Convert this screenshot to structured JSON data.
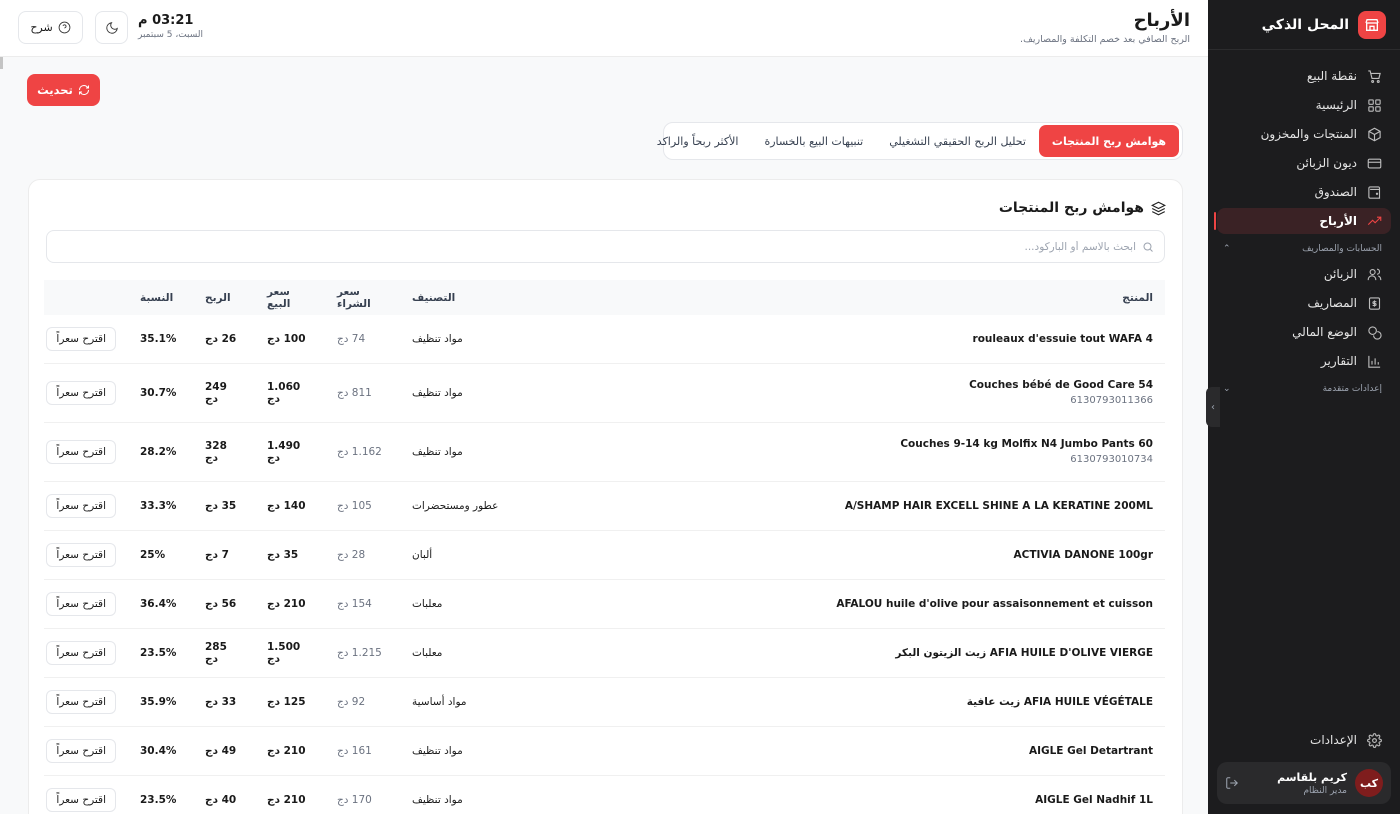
{
  "sidebar": {
    "brand": "المحل الذكي",
    "items": [
      {
        "label": "نقطة البيع",
        "icon": "cart-icon"
      },
      {
        "label": "الرئيسية",
        "icon": "grid-icon"
      },
      {
        "label": "المنتجات والمخزون",
        "icon": "box-icon"
      },
      {
        "label": "ديون الزبائن",
        "icon": "card-icon"
      },
      {
        "label": "الصندوق",
        "icon": "wallet-icon"
      },
      {
        "label": "الأرباح",
        "icon": "trend-icon"
      }
    ],
    "section_accounts": "الحسابات والمصاريف",
    "items2": [
      {
        "label": "الزبائن",
        "icon": "users-icon"
      },
      {
        "label": "المصاريف",
        "icon": "dollar-icon"
      },
      {
        "label": "الوضع المالي",
        "icon": "coins-icon"
      },
      {
        "label": "التقارير",
        "icon": "bar-chart-icon"
      }
    ],
    "section_advanced": "إعدادات متقدمة",
    "settings": "الإعدادات",
    "user_name": "كريم بلقاسم",
    "user_role": "مدير النظام",
    "user_initials": "كب"
  },
  "header": {
    "title": "الأرباح",
    "subtitle": "الربح الصافي بعد خصم التكلفة والمصاريف.",
    "time": "03:21 م",
    "date": "السبت، 5 سبتمبر",
    "explain_label": "شرح"
  },
  "refresh_label": "تحديث",
  "tabs": [
    "هوامش ربح المنتجات",
    "تحليل الربح الحقيقي التشغيلي",
    "تنبيهات البيع بالخسارة",
    "الأكثر ربحاً والراكد"
  ],
  "card": {
    "title": "هوامش ربح المنتجات",
    "search_placeholder": "ابحث بالاسم أو الباركود..."
  },
  "table": {
    "headers": {
      "product": "المنتج",
      "category": "التصنيف",
      "buy": "سعر الشراء",
      "sell": "سعر البيع",
      "profit": "الربح",
      "ratio": "النسبة"
    },
    "suggest_label": "اقترح سعراً",
    "rows": [
      {
        "name": "rouleaux d'essuie tout WAFA 4",
        "code": "",
        "category": "مواد تنظيف",
        "buy": "74 دج",
        "sell": "100 دج",
        "profit": "26 دج",
        "ratio": "35.1%"
      },
      {
        "name": "Couches bébé de Good Care 54",
        "code": "6130793011366",
        "category": "مواد تنظيف",
        "buy": "811 دج",
        "sell": "1.060 دج",
        "profit": "249 دج",
        "ratio": "30.7%"
      },
      {
        "name": "Couches 9-14 kg Molfix N4 Jumbo Pants 60",
        "code": "6130793010734",
        "category": "مواد تنظيف",
        "buy": "1.162 دج",
        "sell": "1.490 دج",
        "profit": "328 دج",
        "ratio": "28.2%"
      },
      {
        "name": "A/SHAMP HAIR EXCELL SHINE A LA KERATINE 200ML",
        "code": "",
        "category": "عطور ومستحضرات",
        "buy": "105 دج",
        "sell": "140 دج",
        "profit": "35 دج",
        "ratio": "33.3%"
      },
      {
        "name": "ACTIVIA DANONE 100gr",
        "code": "",
        "category": "ألبان",
        "buy": "28 دج",
        "sell": "35 دج",
        "profit": "7 دج",
        "ratio": "25%"
      },
      {
        "name": "AFALOU huile d'olive pour assaisonnement et cuisson",
        "code": "",
        "category": "معلبات",
        "buy": "154 دج",
        "sell": "210 دج",
        "profit": "56 دج",
        "ratio": "36.4%"
      },
      {
        "name": "AFIA HUILE D'OLIVE VIERGE زيت الزيتون البكر",
        "code": "",
        "category": "معلبات",
        "buy": "1.215 دج",
        "sell": "1.500 دج",
        "profit": "285 دج",
        "ratio": "23.5%"
      },
      {
        "name": "AFIA HUILE VÉGÉTALE زيت عافية",
        "code": "",
        "category": "مواد أساسية",
        "buy": "92 دج",
        "sell": "125 دج",
        "profit": "33 دج",
        "ratio": "35.9%"
      },
      {
        "name": "AIGLE Gel Detartrant",
        "code": "",
        "category": "مواد تنظيف",
        "buy": "161 دج",
        "sell": "210 دج",
        "profit": "49 دج",
        "ratio": "30.4%"
      },
      {
        "name": "AIGLE Gel Nadhif 1L",
        "code": "",
        "category": "مواد تنظيف",
        "buy": "170 دج",
        "sell": "210 دج",
        "profit": "40 دج",
        "ratio": "23.5%"
      }
    ]
  }
}
